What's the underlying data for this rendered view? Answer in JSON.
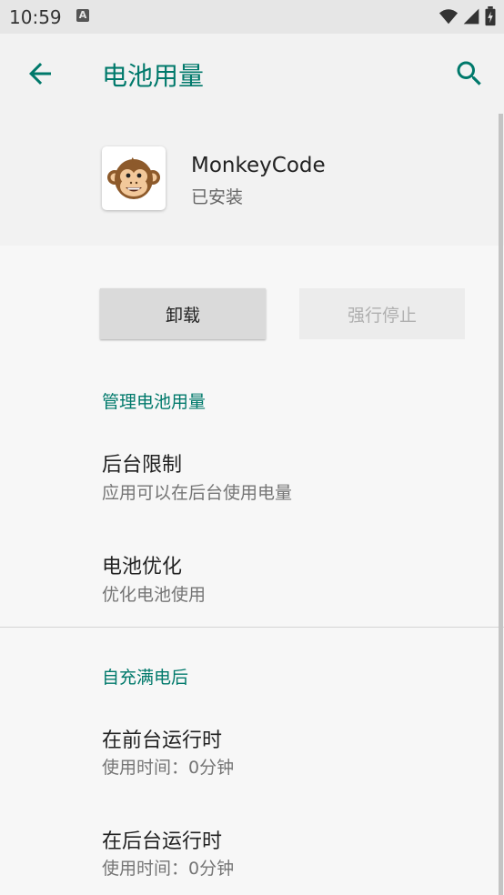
{
  "status_bar": {
    "time": "10:59",
    "notification_icon": "A"
  },
  "app_bar": {
    "title": "电池用量"
  },
  "app_header": {
    "name": "MonkeyCode",
    "status": "已安装"
  },
  "buttons": {
    "uninstall": "卸载",
    "force_stop": "强行停止"
  },
  "manage_section": {
    "header": "管理电池用量",
    "items": [
      {
        "title": "后台限制",
        "subtitle": "应用可以在后台使用电量"
      },
      {
        "title": "电池优化",
        "subtitle": "优化电池使用"
      }
    ]
  },
  "since_full_charge": {
    "header": "自充满电后",
    "items": [
      {
        "title": "在前台运行时",
        "subtitle": "使用时间：0分钟"
      },
      {
        "title": "在后台运行时",
        "subtitle": "使用时间：0分钟"
      }
    ]
  },
  "colors": {
    "accent": "#00796b",
    "background": "#f7f7f7"
  }
}
